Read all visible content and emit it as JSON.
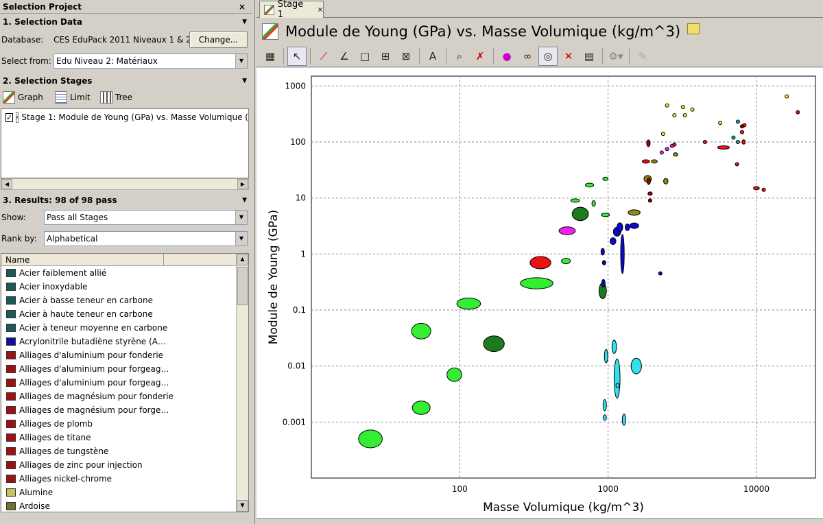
{
  "left": {
    "project_title": "Selection Project",
    "close_glyph": "×",
    "section1": {
      "title": "1. Selection Data",
      "database_label": "Database:",
      "database_value": "CES EduPack 2011 Niveaux 1 & 2",
      "change_button": "Change...",
      "select_from_label": "Select from:",
      "select_from_value": "Edu Niveau 2: Matériaux"
    },
    "section2": {
      "title": "2. Selection Stages",
      "tools": [
        "Graph",
        "Limit",
        "Tree"
      ],
      "stage_item": "Stage 1: Module de Young (GPa) vs. Masse Volumique ("
    },
    "section3": {
      "title": "3. Results: 98 of 98 pass",
      "show_label": "Show:",
      "show_value": "Pass all Stages",
      "rank_label": "Rank by:",
      "rank_value": "Alphabetical",
      "column_header": "Name",
      "items": [
        {
          "name": "Acier faiblement allié",
          "color": "#1a5a5a"
        },
        {
          "name": "Acier inoxydable",
          "color": "#1a5a5a"
        },
        {
          "name": "Acier à basse teneur en carbone",
          "color": "#1a5a5a"
        },
        {
          "name": "Acier à haute teneur en carbone",
          "color": "#1a5a5a"
        },
        {
          "name": "Acier à teneur moyenne en carbone",
          "color": "#1a5a5a"
        },
        {
          "name": "Acrylonitrile butadiène styrène (A…",
          "color": "#1010a0"
        },
        {
          "name": "Alliages d'aluminium pour fonderie",
          "color": "#a01010"
        },
        {
          "name": "Alliages d'aluminium pour forgeag…",
          "color": "#a01010"
        },
        {
          "name": "Alliages d'aluminium pour forgeag…",
          "color": "#a01010"
        },
        {
          "name": "Alliages de magnésium pour fonderie",
          "color": "#a01010"
        },
        {
          "name": "Alliages de magnésium pour forge…",
          "color": "#a01010"
        },
        {
          "name": "Alliages de plomb",
          "color": "#a01010"
        },
        {
          "name": "Alliages de titane",
          "color": "#a01010"
        },
        {
          "name": "Alliages de tungstène",
          "color": "#a01010"
        },
        {
          "name": "Alliages de zinc pour injection",
          "color": "#a01010"
        },
        {
          "name": "Alliages nickel-chrome",
          "color": "#a01010"
        },
        {
          "name": "Alumine",
          "color": "#c8c060"
        },
        {
          "name": "Ardoise",
          "color": "#707030"
        }
      ]
    }
  },
  "right": {
    "tab_label": "Stage 1",
    "tab_close": "×",
    "chart_title": "Module de Young (GPa) vs. Masse Volumique (kg/m^3)"
  },
  "colors": {
    "green": "#33ee33",
    "dark_green": "#1e7a1e",
    "blue": "#0a0acc",
    "cyan": "#33e0ee",
    "red": "#ee1111",
    "dark_red": "#990000",
    "olive": "#8a8a10",
    "magenta": "#ee22ee",
    "yellow": "#eeee11",
    "teal": "#20a0a0"
  },
  "chart_data": {
    "type": "scatter",
    "title": "",
    "xlabel": "Masse Volumique (kg/m^3)",
    "ylabel": "Module de Young (GPa)",
    "xscale": "log",
    "yscale": "log",
    "xlim": [
      10,
      25000
    ],
    "ylim": [
      0.0001,
      1500
    ],
    "xticks": [
      {
        "v": 100,
        "label": "100"
      },
      {
        "v": 1000,
        "label": "1000"
      },
      {
        "v": 10000,
        "label": "10000"
      }
    ],
    "yticks": [
      {
        "v": 1000,
        "label": "1000"
      },
      {
        "v": 100,
        "label": "100"
      },
      {
        "v": 10,
        "label": "10"
      },
      {
        "v": 1,
        "label": "1"
      },
      {
        "v": 0.1,
        "label": "0.1"
      },
      {
        "v": 0.01,
        "label": "0.01"
      },
      {
        "v": 0.001,
        "label": "0.001"
      }
    ],
    "grid": true,
    "bubbles": [
      {
        "x": 25,
        "y": 0.0005,
        "rx": 0.08,
        "ry": 0.16,
        "c": "green"
      },
      {
        "x": 55,
        "y": 0.0018,
        "rx": 0.06,
        "ry": 0.12,
        "c": "green"
      },
      {
        "x": 92,
        "y": 0.007,
        "rx": 0.05,
        "ry": 0.12,
        "c": "green"
      },
      {
        "x": 55,
        "y": 0.042,
        "rx": 0.065,
        "ry": 0.14,
        "c": "green"
      },
      {
        "x": 115,
        "y": 0.13,
        "rx": 0.08,
        "ry": 0.1,
        "c": "green"
      },
      {
        "x": 330,
        "y": 0.3,
        "rx": 0.11,
        "ry": 0.1,
        "c": "green"
      },
      {
        "x": 170,
        "y": 0.025,
        "rx": 0.07,
        "ry": 0.14,
        "c": "dark_green"
      },
      {
        "x": 350,
        "y": 0.7,
        "rx": 0.07,
        "ry": 0.11,
        "c": "red"
      },
      {
        "x": 520,
        "y": 0.75,
        "rx": 0.03,
        "ry": 0.05,
        "c": "green"
      },
      {
        "x": 530,
        "y": 2.6,
        "rx": 0.055,
        "ry": 0.07,
        "c": "magenta"
      },
      {
        "x": 650,
        "y": 5.2,
        "rx": 0.055,
        "ry": 0.12,
        "c": "dark_green"
      },
      {
        "x": 800,
        "y": 8,
        "rx": 0.012,
        "ry": 0.05,
        "c": "green"
      },
      {
        "x": 600,
        "y": 9,
        "rx": 0.03,
        "ry": 0.02,
        "c": "green"
      },
      {
        "x": 750,
        "y": 17,
        "rx": 0.028,
        "ry": 0.035,
        "c": "green"
      },
      {
        "x": 960,
        "y": 5,
        "rx": 0.028,
        "ry": 0.03,
        "c": "green"
      },
      {
        "x": 960,
        "y": 22,
        "rx": 0.018,
        "ry": 0.02,
        "c": "green"
      },
      {
        "x": 920,
        "y": 0.22,
        "rx": 0.025,
        "ry": 0.14,
        "c": "dark_green"
      },
      {
        "x": 930,
        "y": 0.3,
        "rx": 0.008,
        "ry": 0.07,
        "c": "blue"
      },
      {
        "x": 920,
        "y": 1.1,
        "rx": 0.01,
        "ry": 0.06,
        "c": "blue"
      },
      {
        "x": 940,
        "y": 0.7,
        "rx": 0.01,
        "ry": 0.04,
        "c": "blue"
      },
      {
        "x": 1080,
        "y": 1.7,
        "rx": 0.02,
        "ry": 0.06,
        "c": "blue"
      },
      {
        "x": 1150,
        "y": 2.5,
        "rx": 0.025,
        "ry": 0.08,
        "c": "blue"
      },
      {
        "x": 1250,
        "y": 1.0,
        "rx": 0.012,
        "ry": 0.35,
        "c": "blue"
      },
      {
        "x": 1200,
        "y": 3.0,
        "rx": 0.02,
        "ry": 0.08,
        "c": "blue"
      },
      {
        "x": 1500,
        "y": 3.2,
        "rx": 0.03,
        "ry": 0.05,
        "c": "blue"
      },
      {
        "x": 1350,
        "y": 3.0,
        "rx": 0.015,
        "ry": 0.06,
        "c": "blue"
      },
      {
        "x": 2250,
        "y": 0.45,
        "rx": 0.008,
        "ry": 0.03,
        "c": "blue"
      },
      {
        "x": 970,
        "y": 0.015,
        "rx": 0.008,
        "ry": 0.12,
        "c": "cyan"
      },
      {
        "x": 1100,
        "y": 0.022,
        "rx": 0.015,
        "ry": 0.12,
        "c": "cyan"
      },
      {
        "x": 1150,
        "y": 0.006,
        "rx": 0.02,
        "ry": 0.35,
        "c": "cyan"
      },
      {
        "x": 1160,
        "y": 0.0045,
        "rx": 0.008,
        "ry": 0.04,
        "c": "cyan"
      },
      {
        "x": 1550,
        "y": 0.01,
        "rx": 0.035,
        "ry": 0.14,
        "c": "cyan"
      },
      {
        "x": 950,
        "y": 0.002,
        "rx": 0.01,
        "ry": 0.1,
        "c": "cyan"
      },
      {
        "x": 950,
        "y": 0.0012,
        "rx": 0.007,
        "ry": 0.05,
        "c": "cyan"
      },
      {
        "x": 1280,
        "y": 0.0011,
        "rx": 0.008,
        "ry": 0.1,
        "c": "cyan"
      },
      {
        "x": 1500,
        "y": 5.5,
        "rx": 0.04,
        "ry": 0.05,
        "c": "olive"
      },
      {
        "x": 1850,
        "y": 22,
        "rx": 0.025,
        "ry": 0.06,
        "c": "olive"
      },
      {
        "x": 2050,
        "y": 45,
        "rx": 0.02,
        "ry": 0.03,
        "c": "olive"
      },
      {
        "x": 2450,
        "y": 20,
        "rx": 0.015,
        "ry": 0.05,
        "c": "olive"
      },
      {
        "x": 2850,
        "y": 60,
        "rx": 0.015,
        "ry": 0.03,
        "c": "olive"
      },
      {
        "x": 1880,
        "y": 20,
        "rx": 0.01,
        "ry": 0.06,
        "c": "dark_red"
      },
      {
        "x": 1920,
        "y": 12,
        "rx": 0.015,
        "ry": 0.02,
        "c": "dark_red"
      },
      {
        "x": 1920,
        "y": 9,
        "rx": 0.012,
        "ry": 0.015,
        "c": "dark_red"
      },
      {
        "x": 1800,
        "y": 45,
        "rx": 0.025,
        "ry": 0.02,
        "c": "red"
      },
      {
        "x": 1870,
        "y": 95,
        "rx": 0.007,
        "ry": 0.06,
        "c": "dark_red"
      },
      {
        "x": 2500,
        "y": 75,
        "rx": 0.012,
        "ry": 0.03,
        "c": "magenta"
      },
      {
        "x": 2700,
        "y": 85,
        "rx": 0.012,
        "ry": 0.03,
        "c": "magenta"
      },
      {
        "x": 2300,
        "y": 65,
        "rx": 0.01,
        "ry": 0.02,
        "c": "magenta"
      },
      {
        "x": 2800,
        "y": 90,
        "rx": 0.008,
        "ry": 0.015,
        "c": "red"
      },
      {
        "x": 2350,
        "y": 140,
        "rx": 0.008,
        "ry": 0.015,
        "c": "yellow"
      },
      {
        "x": 2500,
        "y": 450,
        "rx": 0.01,
        "ry": 0.015,
        "c": "yellow"
      },
      {
        "x": 2800,
        "y": 300,
        "rx": 0.01,
        "ry": 0.015,
        "c": "yellow"
      },
      {
        "x": 3200,
        "y": 420,
        "rx": 0.01,
        "ry": 0.015,
        "c": "yellow"
      },
      {
        "x": 3300,
        "y": 300,
        "rx": 0.01,
        "ry": 0.015,
        "c": "yellow"
      },
      {
        "x": 3700,
        "y": 380,
        "rx": 0.01,
        "ry": 0.015,
        "c": "yellow"
      },
      {
        "x": 5700,
        "y": 220,
        "rx": 0.01,
        "ry": 0.015,
        "c": "yellow"
      },
      {
        "x": 16000,
        "y": 650,
        "rx": 0.01,
        "ry": 0.015,
        "c": "yellow"
      },
      {
        "x": 4500,
        "y": 100,
        "rx": 0.012,
        "ry": 0.02,
        "c": "red"
      },
      {
        "x": 6000,
        "y": 80,
        "rx": 0.04,
        "ry": 0.025,
        "c": "red"
      },
      {
        "x": 7000,
        "y": 120,
        "rx": 0.008,
        "ry": 0.015,
        "c": "teal"
      },
      {
        "x": 7500,
        "y": 230,
        "rx": 0.008,
        "ry": 0.015,
        "c": "teal"
      },
      {
        "x": 8000,
        "y": 150,
        "rx": 0.012,
        "ry": 0.03,
        "c": "red"
      },
      {
        "x": 8300,
        "y": 200,
        "rx": 0.01,
        "ry": 0.02,
        "c": "red"
      },
      {
        "x": 7500,
        "y": 100,
        "rx": 0.01,
        "ry": 0.02,
        "c": "teal"
      },
      {
        "x": 8200,
        "y": 100,
        "rx": 0.01,
        "ry": 0.04,
        "c": "red"
      },
      {
        "x": 7400,
        "y": 40,
        "rx": 0.008,
        "ry": 0.015,
        "c": "red"
      },
      {
        "x": 8000,
        "y": 190,
        "rx": 0.008,
        "ry": 0.015,
        "c": "dark_red"
      },
      {
        "x": 10000,
        "y": 15,
        "rx": 0.02,
        "ry": 0.02,
        "c": "red"
      },
      {
        "x": 11200,
        "y": 14,
        "rx": 0.008,
        "ry": 0.015,
        "c": "red"
      },
      {
        "x": 19000,
        "y": 340,
        "rx": 0.01,
        "ry": 0.015,
        "c": "red"
      }
    ]
  }
}
